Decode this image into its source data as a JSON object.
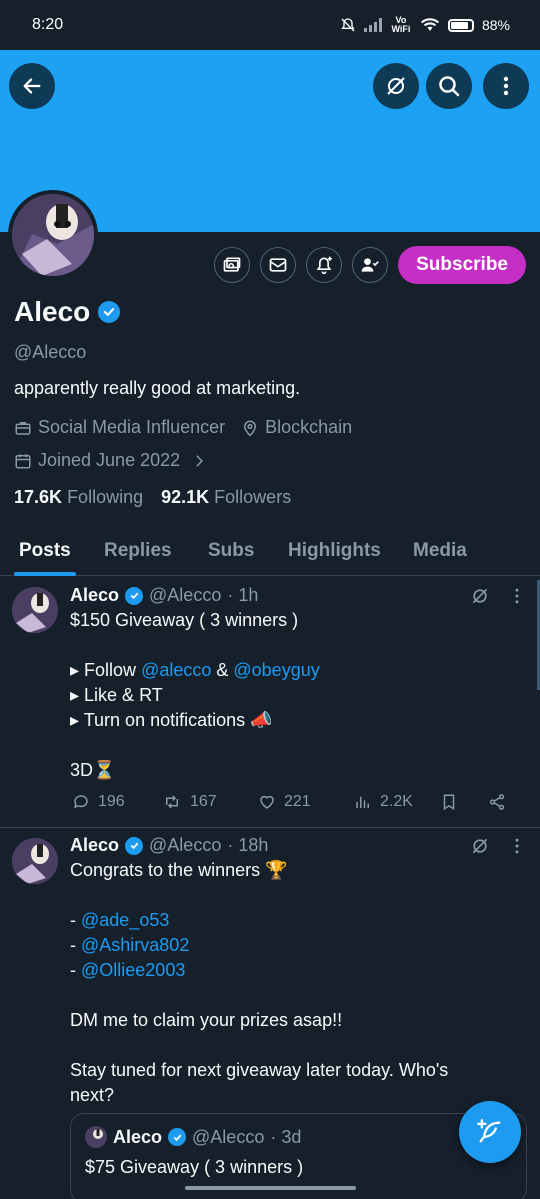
{
  "status_bar": {
    "time": "8:20",
    "network": "Vo WiFi",
    "battery": "88%"
  },
  "header": {
    "back_icon": "arrow-left-icon",
    "icons": [
      "grok-icon",
      "search-icon",
      "more-vertical-icon"
    ]
  },
  "profile": {
    "name": "Aleco",
    "handle": "@Alecco",
    "bio": "apparently really good at marketing.",
    "category": "Social Media Influencer",
    "location": "Blockchain",
    "joined": "Joined June 2022",
    "following_count": "17.6K",
    "following_label": "Following",
    "followers_count": "92.1K",
    "followers_label": "Followers",
    "subscribe_label": "Subscribe",
    "accent_color": "#c62fc6"
  },
  "tabs": [
    "Posts",
    "Replies",
    "Subs",
    "Highlights",
    "Media"
  ],
  "posts": [
    {
      "name": "Aleco",
      "handle": "@Alecco",
      "time": "· 1h",
      "line1": "$150 Giveaway ( 3 winners )",
      "follow_prefix": "▸ Follow ",
      "mention1": "@alecco",
      "amp": " & ",
      "mention2": "@obeyguy",
      "line3": "▸ Like & RT",
      "line4": "▸ Turn on notifications 📣",
      "line5": "3D⏳",
      "replies": "196",
      "reposts": "167",
      "likes": "221",
      "views": "2.2K"
    },
    {
      "name": "Aleco",
      "handle": "@Alecco",
      "time": "· 18h",
      "line1": "Congrats to the winners 🏆",
      "dash": "- ",
      "winner1": "@ade_o53",
      "winner2": "@Ashirva802",
      "winner3": "@Olliee2003",
      "line5": "DM me to claim your prizes asap!!",
      "line6": "Stay tuned for next giveaway later today. Who's",
      "line7": "next?",
      "quote": {
        "name": "Aleco",
        "handle": "@Alecco",
        "time": "· 3d",
        "text": "$75 Giveaway ( 3 winners )"
      }
    }
  ],
  "colors": {
    "background": "#15202b",
    "banner": "#1da1f2",
    "link": "#1d9bf0"
  }
}
